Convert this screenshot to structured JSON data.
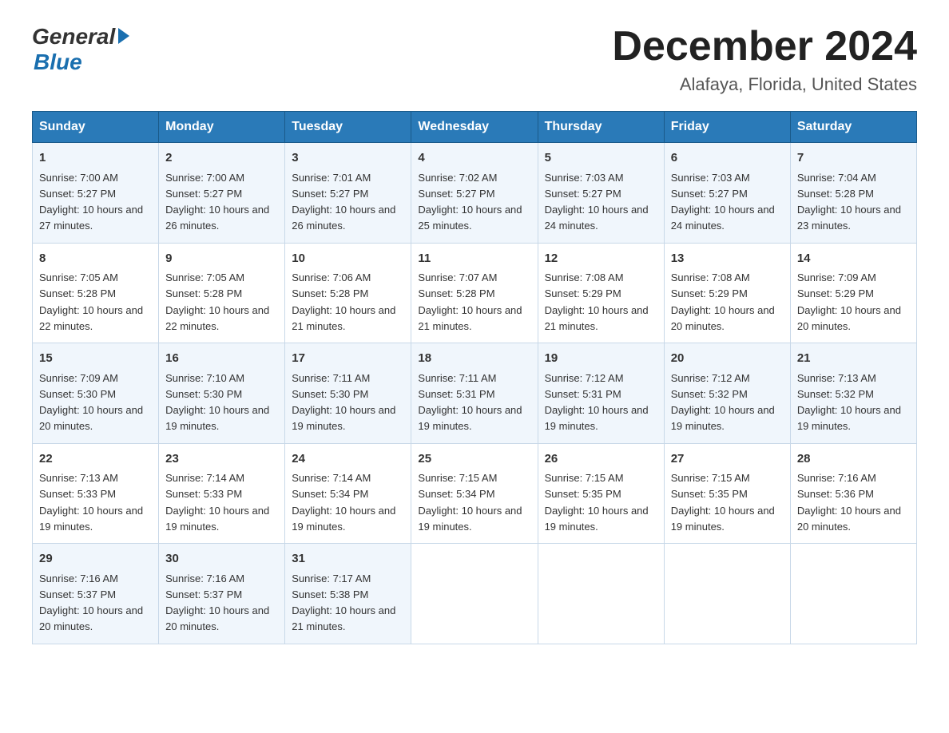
{
  "logo": {
    "general": "General",
    "blue": "Blue"
  },
  "title": "December 2024",
  "subtitle": "Alafaya, Florida, United States",
  "days_header": [
    "Sunday",
    "Monday",
    "Tuesday",
    "Wednesday",
    "Thursday",
    "Friday",
    "Saturday"
  ],
  "weeks": [
    [
      {
        "day": "1",
        "sunrise": "7:00 AM",
        "sunset": "5:27 PM",
        "daylight": "10 hours and 27 minutes."
      },
      {
        "day": "2",
        "sunrise": "7:00 AM",
        "sunset": "5:27 PM",
        "daylight": "10 hours and 26 minutes."
      },
      {
        "day": "3",
        "sunrise": "7:01 AM",
        "sunset": "5:27 PM",
        "daylight": "10 hours and 26 minutes."
      },
      {
        "day": "4",
        "sunrise": "7:02 AM",
        "sunset": "5:27 PM",
        "daylight": "10 hours and 25 minutes."
      },
      {
        "day": "5",
        "sunrise": "7:03 AM",
        "sunset": "5:27 PM",
        "daylight": "10 hours and 24 minutes."
      },
      {
        "day": "6",
        "sunrise": "7:03 AM",
        "sunset": "5:27 PM",
        "daylight": "10 hours and 24 minutes."
      },
      {
        "day": "7",
        "sunrise": "7:04 AM",
        "sunset": "5:28 PM",
        "daylight": "10 hours and 23 minutes."
      }
    ],
    [
      {
        "day": "8",
        "sunrise": "7:05 AM",
        "sunset": "5:28 PM",
        "daylight": "10 hours and 22 minutes."
      },
      {
        "day": "9",
        "sunrise": "7:05 AM",
        "sunset": "5:28 PM",
        "daylight": "10 hours and 22 minutes."
      },
      {
        "day": "10",
        "sunrise": "7:06 AM",
        "sunset": "5:28 PM",
        "daylight": "10 hours and 21 minutes."
      },
      {
        "day": "11",
        "sunrise": "7:07 AM",
        "sunset": "5:28 PM",
        "daylight": "10 hours and 21 minutes."
      },
      {
        "day": "12",
        "sunrise": "7:08 AM",
        "sunset": "5:29 PM",
        "daylight": "10 hours and 21 minutes."
      },
      {
        "day": "13",
        "sunrise": "7:08 AM",
        "sunset": "5:29 PM",
        "daylight": "10 hours and 20 minutes."
      },
      {
        "day": "14",
        "sunrise": "7:09 AM",
        "sunset": "5:29 PM",
        "daylight": "10 hours and 20 minutes."
      }
    ],
    [
      {
        "day": "15",
        "sunrise": "7:09 AM",
        "sunset": "5:30 PM",
        "daylight": "10 hours and 20 minutes."
      },
      {
        "day": "16",
        "sunrise": "7:10 AM",
        "sunset": "5:30 PM",
        "daylight": "10 hours and 19 minutes."
      },
      {
        "day": "17",
        "sunrise": "7:11 AM",
        "sunset": "5:30 PM",
        "daylight": "10 hours and 19 minutes."
      },
      {
        "day": "18",
        "sunrise": "7:11 AM",
        "sunset": "5:31 PM",
        "daylight": "10 hours and 19 minutes."
      },
      {
        "day": "19",
        "sunrise": "7:12 AM",
        "sunset": "5:31 PM",
        "daylight": "10 hours and 19 minutes."
      },
      {
        "day": "20",
        "sunrise": "7:12 AM",
        "sunset": "5:32 PM",
        "daylight": "10 hours and 19 minutes."
      },
      {
        "day": "21",
        "sunrise": "7:13 AM",
        "sunset": "5:32 PM",
        "daylight": "10 hours and 19 minutes."
      }
    ],
    [
      {
        "day": "22",
        "sunrise": "7:13 AM",
        "sunset": "5:33 PM",
        "daylight": "10 hours and 19 minutes."
      },
      {
        "day": "23",
        "sunrise": "7:14 AM",
        "sunset": "5:33 PM",
        "daylight": "10 hours and 19 minutes."
      },
      {
        "day": "24",
        "sunrise": "7:14 AM",
        "sunset": "5:34 PM",
        "daylight": "10 hours and 19 minutes."
      },
      {
        "day": "25",
        "sunrise": "7:15 AM",
        "sunset": "5:34 PM",
        "daylight": "10 hours and 19 minutes."
      },
      {
        "day": "26",
        "sunrise": "7:15 AM",
        "sunset": "5:35 PM",
        "daylight": "10 hours and 19 minutes."
      },
      {
        "day": "27",
        "sunrise": "7:15 AM",
        "sunset": "5:35 PM",
        "daylight": "10 hours and 19 minutes."
      },
      {
        "day": "28",
        "sunrise": "7:16 AM",
        "sunset": "5:36 PM",
        "daylight": "10 hours and 20 minutes."
      }
    ],
    [
      {
        "day": "29",
        "sunrise": "7:16 AM",
        "sunset": "5:37 PM",
        "daylight": "10 hours and 20 minutes."
      },
      {
        "day": "30",
        "sunrise": "7:16 AM",
        "sunset": "5:37 PM",
        "daylight": "10 hours and 20 minutes."
      },
      {
        "day": "31",
        "sunrise": "7:17 AM",
        "sunset": "5:38 PM",
        "daylight": "10 hours and 21 minutes."
      },
      null,
      null,
      null,
      null
    ]
  ]
}
